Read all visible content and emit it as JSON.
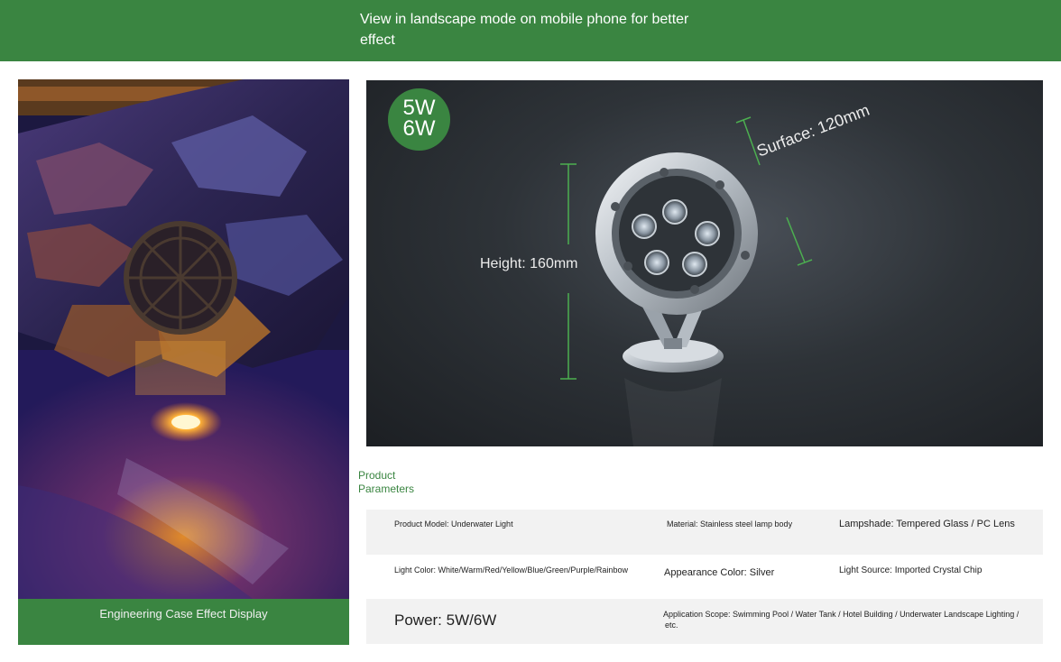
{
  "banner": {
    "notice": "View in landscape mode on mobile phone for better effect"
  },
  "case_display": {
    "caption": "Engineering Case Effect Display"
  },
  "product_image": {
    "badge_line1": "5W",
    "badge_line2": "6W",
    "height_label": "Height: 160mm",
    "surface_label": "Surface: 120mm"
  },
  "parameters": {
    "heading_line1": "Product",
    "heading_line2": "Parameters",
    "model": "Product Model: Underwater Light",
    "material": "Material: Stainless steel lamp body",
    "lampshade": "Lampshade: Tempered Glass / PC Lens",
    "light_color": "Light Color: White/Warm/Red/Yellow/Blue/Green/Purple/Rainbow",
    "appearance": "Appearance Color: Silver",
    "light_source": "Light Source: Imported Crystal Chip",
    "power": "Power: 5W/6W",
    "application_line1": "Application Scope: Swimming Pool / Water Tank / Hotel Building / Underwater Landscape Lighting /",
    "application_line2": "etc."
  },
  "colors": {
    "brand_green": "#3a8541",
    "dimension_green": "#4caf50",
    "row_gray": "#f2f2f2"
  }
}
